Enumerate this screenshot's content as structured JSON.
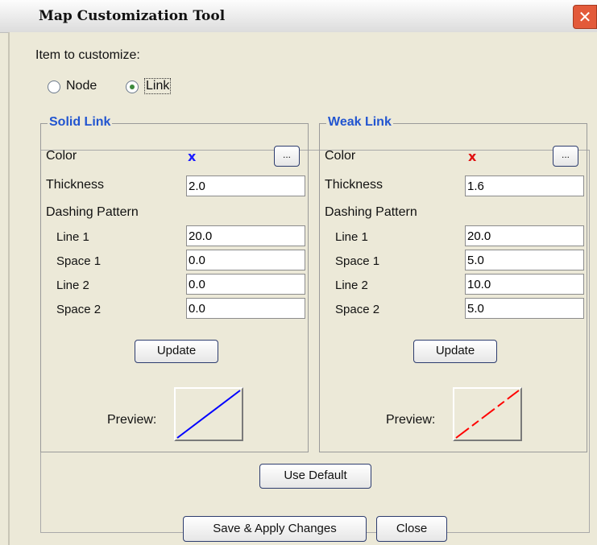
{
  "window": {
    "title": "Map Customization Tool",
    "close_glyph": "✕"
  },
  "item_to_customize": {
    "label": "Item to customize:",
    "options": [
      {
        "label": "Node",
        "selected": false
      },
      {
        "label": "Link",
        "selected": true
      }
    ]
  },
  "solid_link": {
    "title": "Solid Link",
    "color_label": "Color",
    "color_mark": "x",
    "color_value": "#0000ff",
    "browse_label": "...",
    "thickness_label": "Thickness",
    "thickness": "2.0",
    "dashing_label": "Dashing Pattern",
    "line1_label": "Line 1",
    "line1": "20.0",
    "space1_label": "Space 1",
    "space1": "0.0",
    "line2_label": "Line 2",
    "line2": "0.0",
    "space2_label": "Space 2",
    "space2": "0.0",
    "update_label": "Update",
    "preview_label": "Preview:"
  },
  "weak_link": {
    "title": "Weak Link",
    "color_label": "Color",
    "color_mark": "x",
    "color_value": "#ff0000",
    "browse_label": "...",
    "thickness_label": "Thickness",
    "thickness": "1.6",
    "dashing_label": "Dashing Pattern",
    "line1_label": "Line 1",
    "line1": "20.0",
    "space1_label": "Space 1",
    "space1": "5.0",
    "line2_label": "Line 2",
    "line2": "10.0",
    "space2_label": "Space 2",
    "space2": "5.0",
    "update_label": "Update",
    "preview_label": "Preview:"
  },
  "buttons": {
    "use_default": "Use Default",
    "save_apply": "Save & Apply Changes",
    "close": "Close"
  }
}
